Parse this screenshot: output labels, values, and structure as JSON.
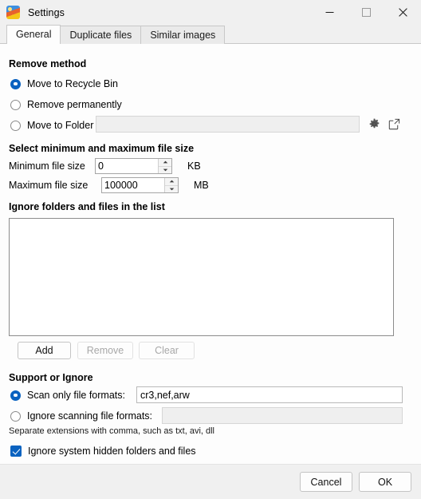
{
  "window": {
    "title": "Settings",
    "icon": "image-app-icon",
    "controls": [
      {
        "name": "minimize",
        "glyph": "minimize-icon"
      },
      {
        "name": "maximize",
        "glyph": "maximize-icon"
      },
      {
        "name": "close",
        "glyph": "close-icon"
      }
    ]
  },
  "tabs": [
    {
      "label": "General",
      "active": true
    },
    {
      "label": "Duplicate files",
      "active": false
    },
    {
      "label": "Similar images",
      "active": false
    }
  ],
  "remove_method": {
    "title": "Remove method",
    "options": [
      {
        "label": "Move to Recycle Bin",
        "selected": true
      },
      {
        "label": "Remove permanently",
        "selected": false
      },
      {
        "label": "Move to Folder",
        "selected": false
      }
    ],
    "folder_path_value": "",
    "folder_path_placeholder": "",
    "gear_icon": "gear-icon",
    "open_icon": "external-link-icon"
  },
  "file_size": {
    "title": "Select minimum and maximum file size",
    "minimum": {
      "label": "Minimum file size",
      "value": "0",
      "unit": "KB"
    },
    "maximum": {
      "label": "Maximum file size",
      "value": "100000",
      "unit": "MB"
    }
  },
  "ignore_list": {
    "title": "Ignore folders and files in the list",
    "items": [],
    "buttons": [
      {
        "label": "Add",
        "enabled": true
      },
      {
        "label": "Remove",
        "enabled": false
      },
      {
        "label": "Clear",
        "enabled": false
      }
    ]
  },
  "support_ignore": {
    "title": "Support or Ignore",
    "scan_only": {
      "label": "Scan only file formats:",
      "selected": true,
      "value": "cr3,nef,arw"
    },
    "ignore_scanning": {
      "label": "Ignore scanning file formats:",
      "selected": false,
      "value": ""
    },
    "hint": "Separate extensions with comma, such as txt, avi, dll"
  },
  "hidden_files": {
    "label": "Ignore system hidden folders and files",
    "checked": true
  },
  "footer": {
    "cancel_label": "Cancel",
    "ok_label": "OK"
  },
  "colors": {
    "accent": "#0a62c0",
    "window_bg": "#f0f0f0",
    "panel_bg": "#fdfdfd",
    "close_hover": "#e81123"
  }
}
